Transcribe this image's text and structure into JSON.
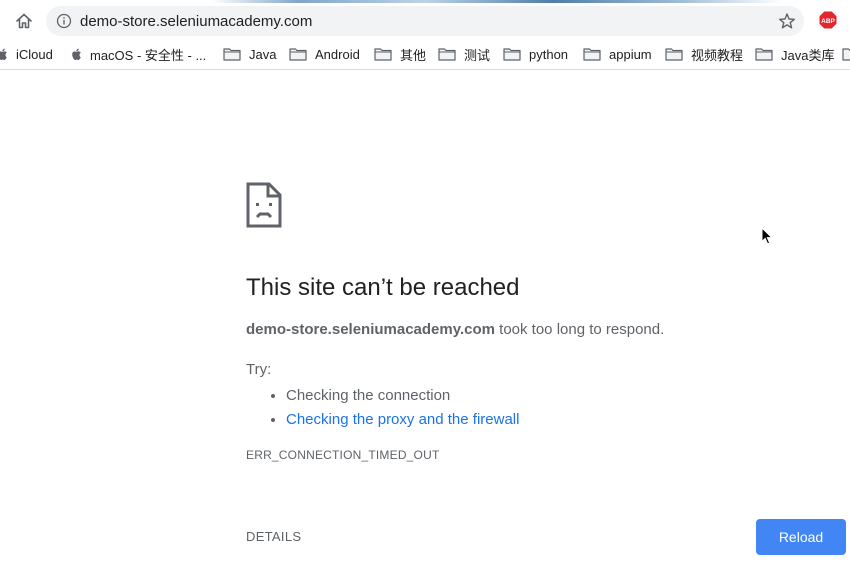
{
  "browser": {
    "url": "demo-store.seleniumacademy.com",
    "icons": {
      "home": "home-icon",
      "info": "info-icon",
      "star": "star-icon",
      "extension": "adblock-icon",
      "folder": "folder-icon"
    },
    "extension_label": "ABP"
  },
  "bookmarks": [
    {
      "label": "iCloud",
      "icon": "apple-icon"
    },
    {
      "label": "macOS - 安全性 - ...",
      "icon": "apple-icon"
    },
    {
      "label": "Java",
      "icon": "folder-icon"
    },
    {
      "label": "Android",
      "icon": "folder-icon"
    },
    {
      "label": "其他",
      "icon": "folder-icon"
    },
    {
      "label": "测试",
      "icon": "folder-icon"
    },
    {
      "label": "python",
      "icon": "folder-icon"
    },
    {
      "label": "appium",
      "icon": "folder-icon"
    },
    {
      "label": "视频教程",
      "icon": "folder-icon"
    },
    {
      "label": "Java类库",
      "icon": "folder-icon"
    }
  ],
  "error_page": {
    "icon": "sad-page-icon",
    "title": "This site can’t be reached",
    "host": "demo-store.seleniumacademy.com",
    "message": " took too long to respond.",
    "try_label": "Try:",
    "suggestions": [
      "Checking the connection",
      "Checking the proxy and the firewall"
    ],
    "error_code": "ERR_CONNECTION_TIMED_OUT",
    "details_label": "DETAILS",
    "reload_label": "Reload"
  },
  "colors": {
    "accent": "#4285f4",
    "link": "#1a73e8",
    "text": "#202124",
    "secondary_text": "#5f6368"
  }
}
